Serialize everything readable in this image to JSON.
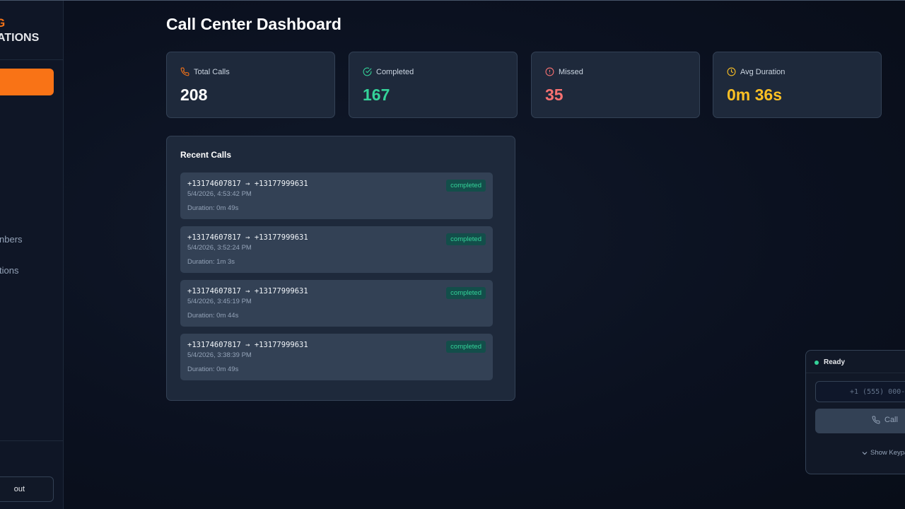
{
  "sidebar": {
    "brand_top": "G",
    "brand_bottom": "ATIONS",
    "nav_items": [
      {
        "label": "..."
      },
      {
        "label": "nbers"
      },
      {
        "label": "tions"
      }
    ],
    "logout_label": "out"
  },
  "header": {
    "title": "Call Center Dashboard"
  },
  "stats": [
    {
      "label": "Total Calls",
      "value": "208",
      "icon": "phone-icon",
      "color": "#ffffff",
      "icon_color": "#f97316"
    },
    {
      "label": "Completed",
      "value": "167",
      "icon": "check-circle-icon",
      "color": "#34d399",
      "icon_color": "#34d399"
    },
    {
      "label": "Missed",
      "value": "35",
      "icon": "alert-circle-icon",
      "color": "#f87171",
      "icon_color": "#f87171"
    },
    {
      "label": "Avg Duration",
      "value": "0m 36s",
      "icon": "clock-icon",
      "color": "#fbbf24",
      "icon_color": "#fbbf24"
    }
  ],
  "recent_calls": {
    "title": "Recent Calls",
    "items": [
      {
        "numbers": "+13174607817 → +13177999631",
        "time": "5/4/2026, 4:53:42 PM",
        "duration": "Duration: 0m 49s",
        "status": "completed"
      },
      {
        "numbers": "+13174607817 → +13177999631",
        "time": "5/4/2026, 3:52:24 PM",
        "duration": "Duration: 1m 3s",
        "status": "completed"
      },
      {
        "numbers": "+13174607817 → +13177999631",
        "time": "5/4/2026, 3:45:19 PM",
        "duration": "Duration: 0m 44s",
        "status": "completed"
      },
      {
        "numbers": "+13174607817 → +13177999631",
        "time": "5/4/2026, 3:38:39 PM",
        "duration": "Duration: 0m 49s",
        "status": "completed"
      }
    ]
  },
  "dialer": {
    "status": "Ready",
    "status_color": "#34d399",
    "input_placeholder": "+1 (555) 000-",
    "call_label": "Call",
    "keypad_label": "Show Keypa"
  },
  "colors": {
    "accent": "#f97316",
    "success": "#34d399",
    "danger": "#f87171",
    "warning": "#fbbf24"
  }
}
